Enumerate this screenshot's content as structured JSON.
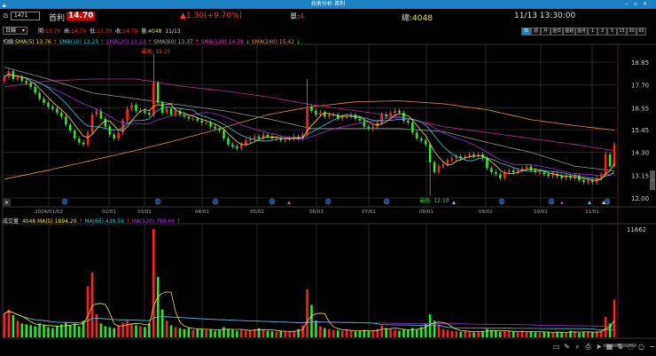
{
  "window": {
    "title": "技術分析-首利"
  },
  "header": {
    "code": "1471",
    "name": "首利",
    "price": "14.70",
    "change": "▲1.30(+9.70%)",
    "single_label": "單:",
    "single_value": "4",
    "total_label": "總:",
    "total_value": "4048",
    "datetime": "11/13 13:30:00"
  },
  "ohlc": {
    "period_select": "日線",
    "open_label": "開:",
    "open": "13.70",
    "high_label": "高:",
    "high": "14.70",
    "low_label": "低:",
    "low": "13.70",
    "close_label": "收:",
    "close": "14.70",
    "vol_label": "量:",
    "vol": "4048",
    "date": "11/13"
  },
  "periods": [
    "日",
    "週",
    "月",
    "還日",
    "還週",
    "還月",
    "1",
    "3",
    "5",
    "15",
    "30",
    "60"
  ],
  "price_legend": {
    "label": "均線:",
    "items": [
      {
        "text": "SMA(5) 13.76",
        "arrow": "↑",
        "color": "#f0e040"
      },
      {
        "text": "SMA(10) 13.23",
        "arrow": "↑",
        "color": "#3cc8d8"
      },
      {
        "text": "SMA(20) 13.13",
        "arrow": "↑",
        "color": "#b040e0"
      },
      {
        "text": "SMA(60) 13.37",
        "arrow": "↑",
        "color": "#b0b0b0"
      },
      {
        "text": "SMA(120) 14.38",
        "arrow": "↓",
        "color": "#e040b0"
      },
      {
        "text": "SMA(240) 15.42",
        "arrow": "↓",
        "color": "#f08c30"
      }
    ]
  },
  "annotations": {
    "max_label": "最高: 19.25",
    "min_label": "最低: 12.10"
  },
  "price_axis": [
    "18.85",
    "17.70",
    "16.55",
    "15.45",
    "14.30",
    "13.15",
    "12.00"
  ],
  "date_axis": [
    "2024/01/02",
    "02/01",
    "03/01",
    "04/01",
    "05/02",
    "06/03",
    "07/01",
    "08/01",
    "09/02",
    "10/01",
    "11/01"
  ],
  "volume_legend": {
    "label": "成交量",
    "value": "4048",
    "items": [
      {
        "text": "MA(5) 1894.20",
        "arrow": "↑",
        "color": "#f0e040"
      },
      {
        "text": "MA(66) 439.59",
        "arrow": "↑",
        "color": "#3cc8d8"
      },
      {
        "text": "MA(120) 799.66",
        "arrow": "↑",
        "color": "#b040e0"
      }
    ]
  },
  "volume_axis": [
    "11662"
  ],
  "colors": {
    "up": "#ff2020",
    "down": "#22ee22",
    "accent": "#1b7fc0"
  },
  "chart_data": {
    "type": "candlestick",
    "price_range": [
      12.0,
      18.85
    ],
    "closes": [
      18.1,
      18.4,
      18.0,
      18.1,
      17.9,
      17.8,
      17.6,
      17.3,
      17.0,
      16.8,
      16.6,
      16.5,
      16.3,
      16.1,
      15.7,
      15.4,
      15.0,
      14.8,
      14.7,
      15.3,
      16.2,
      16.4,
      16.0,
      15.6,
      15.2,
      15.0,
      15.3,
      15.9,
      16.5,
      16.7,
      16.4,
      16.4,
      16.3,
      16.2,
      17.8,
      16.8,
      16.3,
      16.5,
      16.2,
      16.4,
      16.2,
      16.1,
      16.0,
      16.0,
      15.9,
      15.8,
      15.8,
      15.6,
      15.5,
      15.4,
      15.0,
      14.7,
      14.6,
      14.5,
      14.7,
      14.9,
      15.0,
      15.1,
      15.0,
      15.2,
      15.1,
      15.0,
      15.0,
      14.9,
      15.0,
      15.0,
      15.1,
      15.0,
      15.2,
      16.6,
      16.4,
      16.2,
      16.3,
      16.1,
      16.2,
      16.2,
      16.0,
      16.1,
      16.1,
      16.2,
      16.0,
      15.9,
      15.6,
      15.5,
      15.6,
      15.8,
      16.2,
      16.1,
      16.3,
      16.4,
      16.3,
      15.9,
      15.8,
      15.3,
      15.0,
      14.9,
      14.7,
      13.8,
      13.3,
      13.6,
      13.7,
      13.9,
      14.0,
      14.1,
      14.0,
      14.1,
      14.2,
      14.1,
      14.2,
      14.0,
      13.5,
      13.3,
      13.2,
      13.0,
      13.3,
      13.4,
      13.3,
      13.4,
      13.5,
      13.6,
      13.4,
      13.3,
      13.3,
      13.2,
      13.1,
      13.2,
      13.1,
      13.0,
      13.1,
      13.0,
      13.1,
      12.9,
      12.8,
      12.9,
      12.8,
      13.0,
      13.2,
      14.2,
      13.6,
      14.7
    ],
    "first_open": 17.9,
    "extremes": [
      {
        "index": 34,
        "high": 19.25
      },
      {
        "index": 69,
        "high": 18.0
      },
      {
        "index": 97,
        "low": 12.1
      }
    ],
    "volumes": [
      2600,
      3000,
      2400,
      1800,
      1500,
      1400,
      1300,
      1200,
      1500,
      1300,
      1100,
      1000,
      1200,
      1400,
      1600,
      1300,
      1500,
      1200,
      1800,
      5500,
      7000,
      2500,
      1500,
      1200,
      1100,
      1000,
      1300,
      1600,
      1800,
      1500,
      1300,
      1200,
      1100,
      1500,
      11662,
      6500,
      3000,
      1800,
      1300,
      1100,
      1000,
      900,
      1000,
      800,
      900,
      850,
      800,
      900,
      700,
      800,
      1100,
      900,
      800,
      700,
      800,
      700,
      750,
      900,
      1000,
      800,
      700,
      650,
      600,
      700,
      650,
      600,
      700,
      900,
      1300,
      5200,
      3500,
      1800,
      1200,
      1000,
      900,
      800,
      750,
      700,
      800,
      700,
      650,
      700,
      800,
      700,
      650,
      900,
      1300,
      1000,
      900,
      800,
      700,
      900,
      800,
      1000,
      900,
      1100,
      1500,
      2500,
      1800,
      1300,
      900,
      800,
      700,
      650,
      600,
      700,
      600,
      550,
      600,
      700,
      900,
      800,
      700,
      600,
      650,
      700,
      600,
      550,
      700,
      600,
      650,
      550,
      500,
      600,
      550,
      500,
      600,
      550,
      500,
      700,
      600,
      500,
      600,
      550,
      500,
      650,
      700,
      2200,
      1500,
      4048
    ],
    "ma60_samples": [
      18.6,
      18.0,
      17.3,
      17.0,
      16.7,
      16.4,
      16.0,
      15.5,
      15.5,
      15.5,
      15.35,
      14.8,
      14.3,
      13.6,
      13.37
    ],
    "ma120_samples": [
      17.6,
      17.9,
      18.0,
      18.0,
      17.65,
      17.4,
      17.1,
      16.7,
      16.4,
      16.1,
      15.6,
      15.3,
      15.0,
      14.7,
      14.38
    ],
    "ma240_samples": [
      12.95,
      13.4,
      13.9,
      14.4,
      14.95,
      15.55,
      16.2,
      16.6,
      16.85,
      16.9,
      16.75,
      16.45,
      15.95,
      15.65,
      15.42
    ],
    "volume_max": 11662
  },
  "markers": {
    "circle_glyph": "月",
    "circle_count": 9,
    "triangle_colors": [
      "#e040b0",
      "#aaaaaa",
      "#b030e0",
      "#40c8e0",
      "#f0d040"
    ]
  },
  "toolbar": [
    "▭",
    "✎",
    "⌕",
    "⎙",
    "➤",
    "▦",
    "⇅",
    "◌",
    "○",
    "−",
    "+"
  ],
  "expand_glyph": "»"
}
